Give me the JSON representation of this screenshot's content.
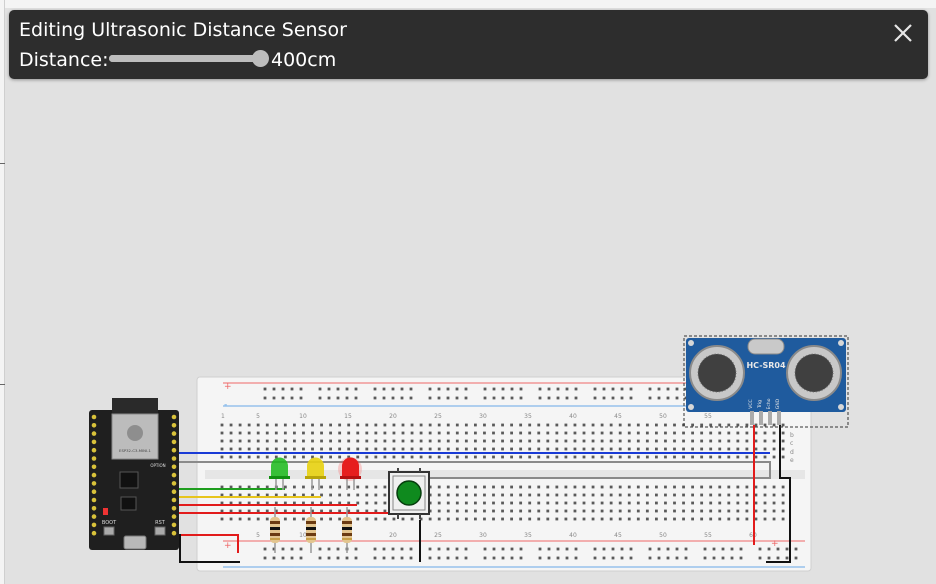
{
  "editor": {
    "title": "Editing Ultrasonic Distance Sensor",
    "distance_label": "Distance:",
    "distance_value": "400cm",
    "distance_fraction": 1.0,
    "close_icon": "close-icon"
  },
  "breadboard": {
    "top_numbers": [
      "5",
      "10",
      "15",
      "20",
      "25",
      "30",
      "35",
      "40",
      "45",
      "50",
      "55"
    ],
    "bottom_numbers": [
      "5",
      "10",
      "15",
      "20",
      "25",
      "30",
      "35",
      "40",
      "45",
      "50",
      "55",
      "60"
    ],
    "first_number": "1",
    "row_letters_right": [
      "b",
      "c",
      "d",
      "e"
    ],
    "rail_plus": "+",
    "rail_minus": "-"
  },
  "sensor": {
    "model": "HC-SR04",
    "pins": [
      "VCC",
      "Trig",
      "Echo",
      "GND"
    ]
  },
  "board": {
    "module_label": "ESP32-C3-MINI-1",
    "button_boot": "BOOT",
    "button_rst": "RST",
    "option_label": "OPTION"
  },
  "colors": {
    "panel_bg": "#2d2d2d",
    "wire_blue": "#1a3bd6",
    "wire_red": "#e21b1b",
    "wire_green": "#1f9e1f",
    "wire_yellow": "#e7c51c",
    "wire_black": "#111111",
    "wire_gray": "#8a8a8a",
    "led_green": "#19b819",
    "led_yellow": "#e8d20f",
    "led_red": "#e61e1e",
    "sensor_blue": "#1f5b9e",
    "board_dark": "#1f1f1f"
  }
}
